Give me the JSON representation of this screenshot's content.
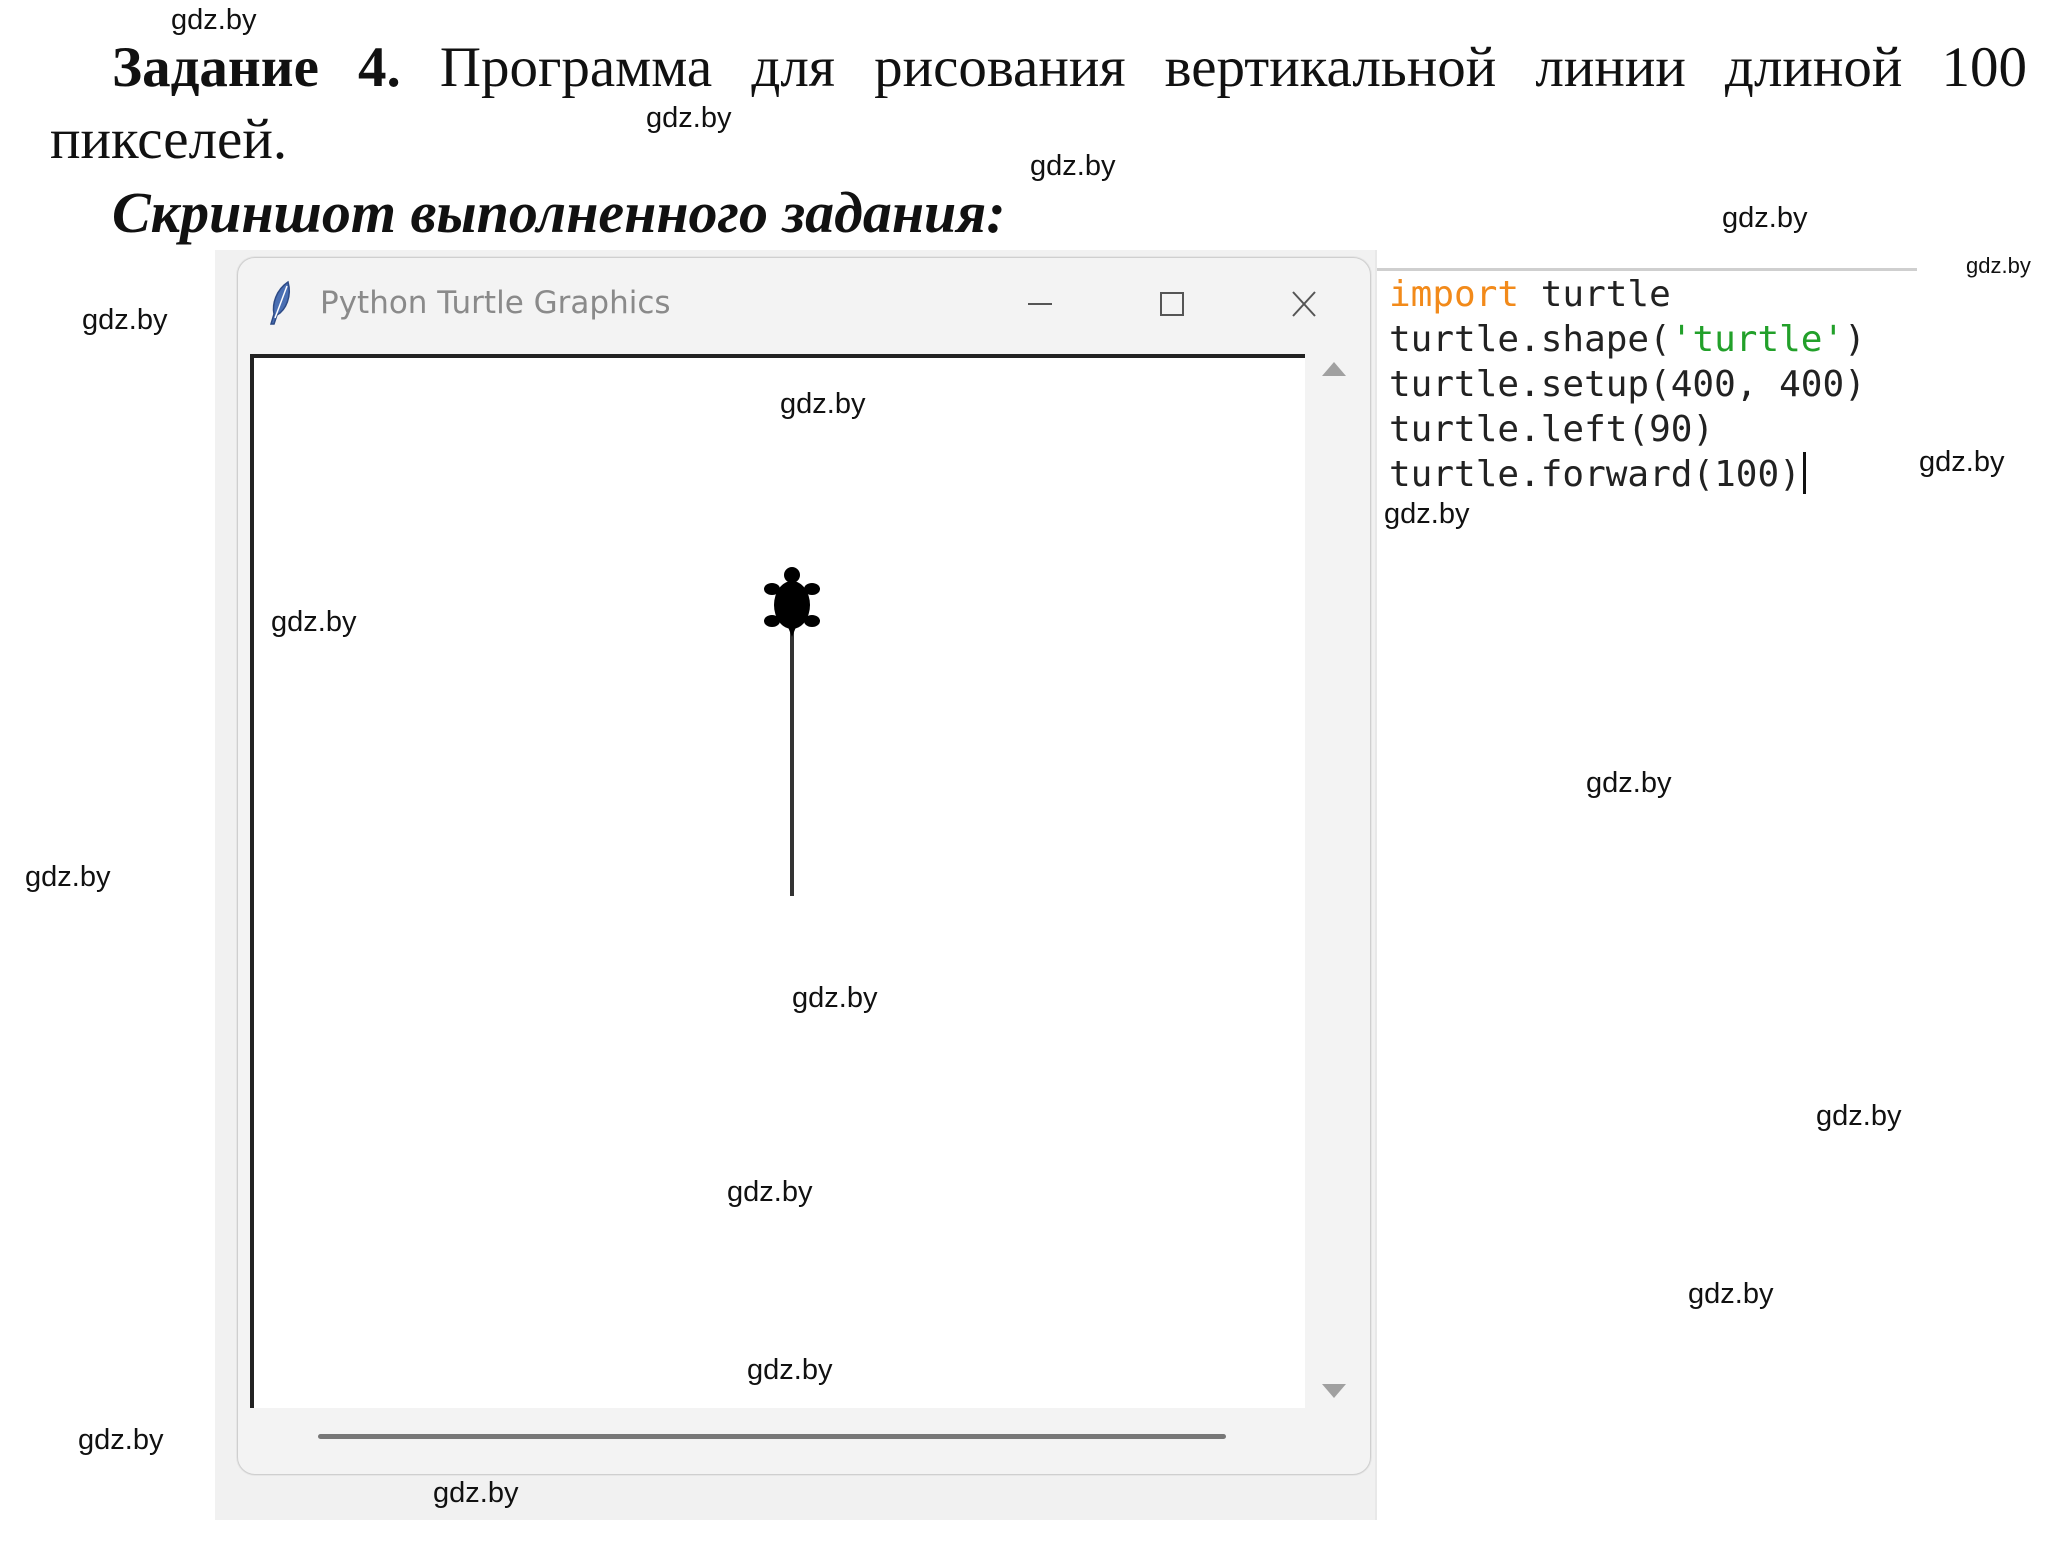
{
  "document": {
    "task_label": "Задание 4.",
    "task_text": "Программа для рисования вертикальной линии длиной 100",
    "task_text_cont": "пикселей.",
    "screenshot_title": "Скриншот выполненного задания:"
  },
  "turtle_window": {
    "title": "Python Turtle Graphics",
    "icons": [
      "feather-icon",
      "minimize-icon",
      "maximize-icon",
      "close-icon"
    ],
    "line_length": 100,
    "heading_degrees": 90,
    "setup_size": [
      400,
      400
    ]
  },
  "editor": {
    "lines": [
      {
        "keyword": "import",
        "rest": " turtle"
      },
      {
        "prefix": "turtle.shape(",
        "string": "'turtle'",
        "suffix": ")"
      },
      {
        "text": "turtle.setup(400, 400)"
      },
      {
        "text": "turtle.left(90)"
      },
      {
        "text": "turtle.forward(100)"
      }
    ],
    "colors": {
      "keyword": "#f28a1a",
      "string": "#22a02a"
    }
  },
  "watermark": "gdz.by"
}
